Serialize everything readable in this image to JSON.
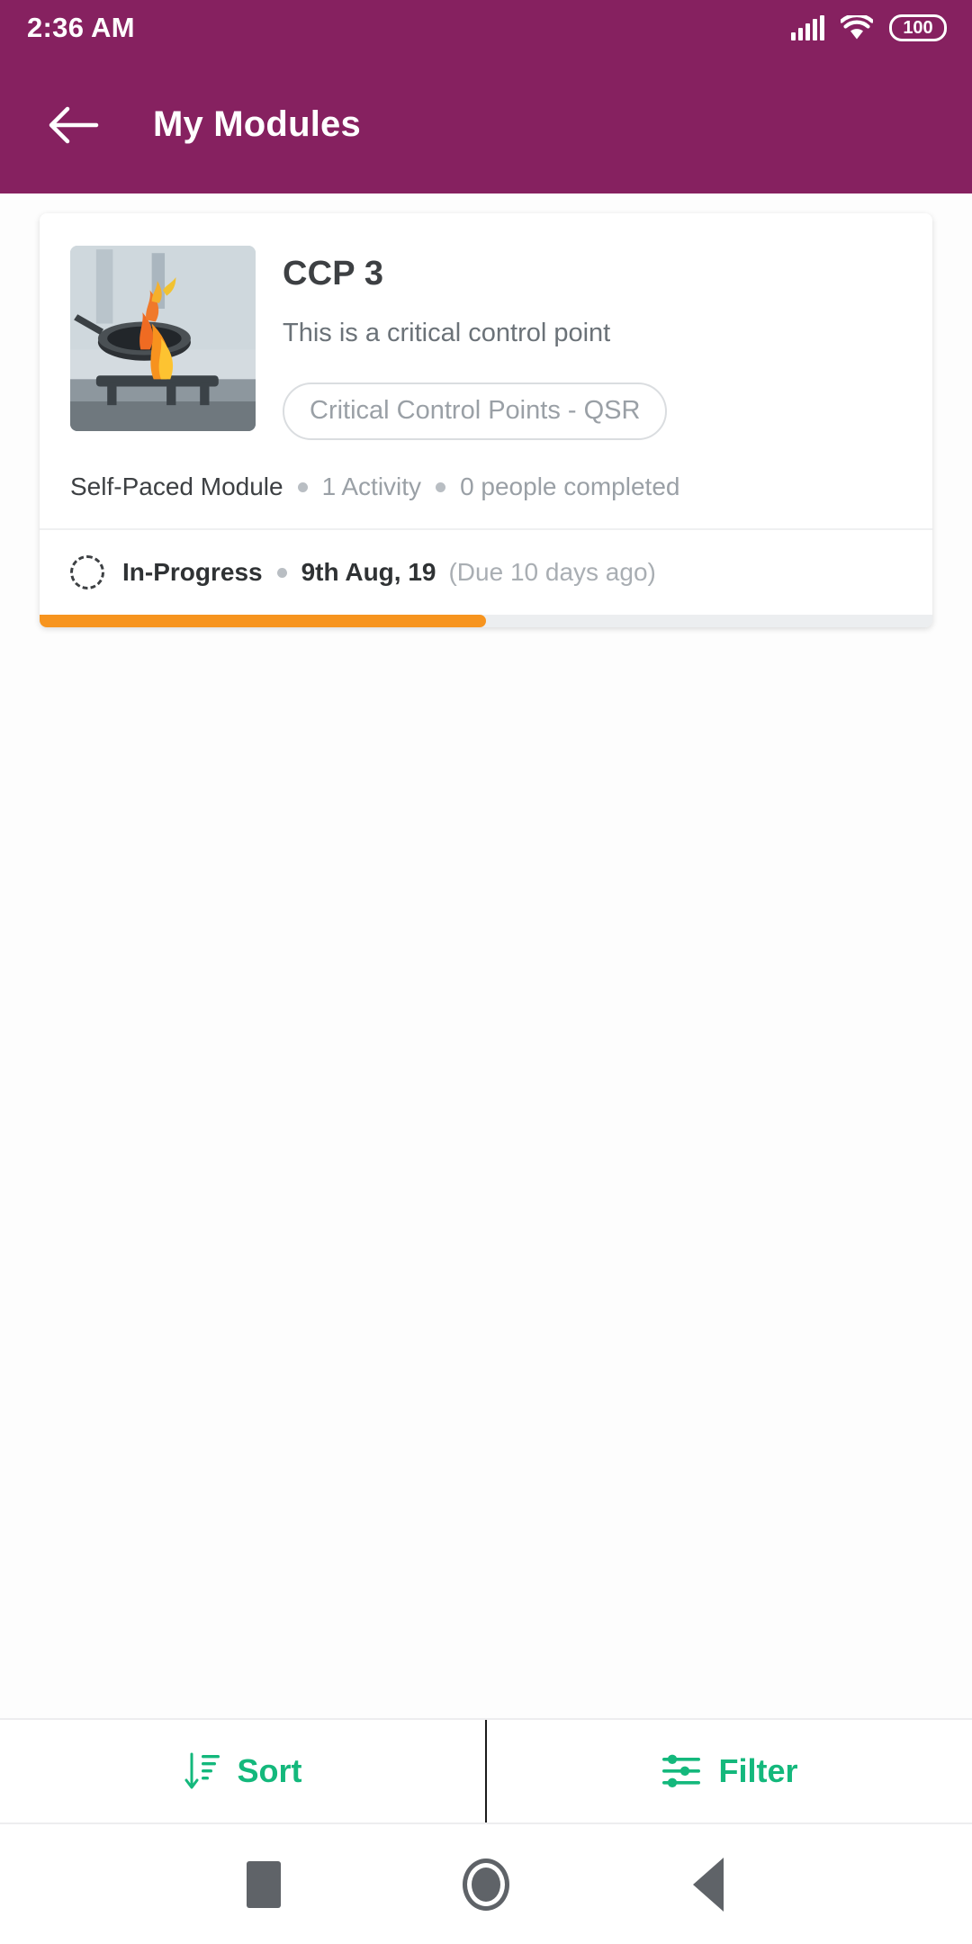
{
  "status_bar": {
    "time": "2:36 AM",
    "signal_icon": "signal-bars-icon",
    "wifi_icon": "wifi-icon",
    "battery_level": "100"
  },
  "app_bar": {
    "back_icon": "back-arrow-icon",
    "title": "My Modules"
  },
  "module_card": {
    "thumbnail_alt": "flaming-pan-photo",
    "title": "CCP 3",
    "description": "This is a critical control point",
    "category_chip": "Critical Control Points - QSR",
    "meta": {
      "type": "Self-Paced Module",
      "activities": "1 Activity",
      "completions": "0 people completed"
    },
    "status": {
      "state_icon": "dashed-circle-icon",
      "state": "In-Progress",
      "date": "9th Aug, 19",
      "due": "(Due 10 days ago)",
      "progress_percent": 50
    }
  },
  "action_bar": {
    "sort_icon": "sort-descending-icon",
    "sort_label": "Sort",
    "filter_icon": "filter-sliders-icon",
    "filter_label": "Filter"
  },
  "nav_bar": {
    "recents_icon": "square-recents-icon",
    "home_icon": "circle-home-icon",
    "back_icon": "triangle-back-icon"
  },
  "colors": {
    "brand_purple": "#862160",
    "accent_green": "#14b87c",
    "progress_orange": "#f7941e"
  }
}
